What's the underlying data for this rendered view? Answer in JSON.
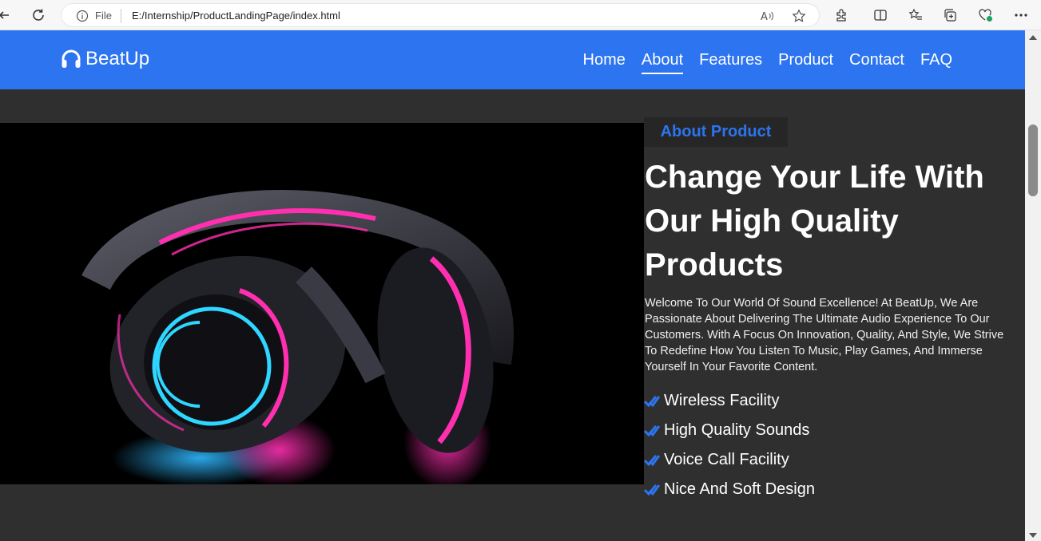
{
  "browser": {
    "url_scheme": "File",
    "url": "E:/Internship/ProductLandingPage/index.html"
  },
  "site": {
    "brand": "BeatUp",
    "nav": [
      {
        "label": "Home"
      },
      {
        "label": "About",
        "active": true
      },
      {
        "label": "Features"
      },
      {
        "label": "Product"
      },
      {
        "label": "Contact"
      },
      {
        "label": "FAQ"
      }
    ]
  },
  "about": {
    "badge": "About Product",
    "title": "Change Your Life With Our High Quality Products",
    "description": "Welcome To Our World Of Sound Excellence! At BeatUp, We Are Passionate About Delivering The Ultimate Audio Experience To Our Customers. With A Focus On Innovation, Quality, And Style, We Strive To Redefine How You Listen To Music, Play Games, And Immerse Yourself In Your Favorite Content.",
    "features": [
      "Wireless Facility",
      "High Quality Sounds",
      "Voice Call Facility",
      "Nice And Soft Design"
    ]
  },
  "colors": {
    "header_blue": "#2c74f0",
    "page_bg": "#2f2f2f",
    "accent_pink": "#ff2fb0",
    "accent_cyan": "#2fd6ff"
  },
  "icons": {
    "logo": "headphones-icon",
    "feature": "double-check-icon"
  }
}
